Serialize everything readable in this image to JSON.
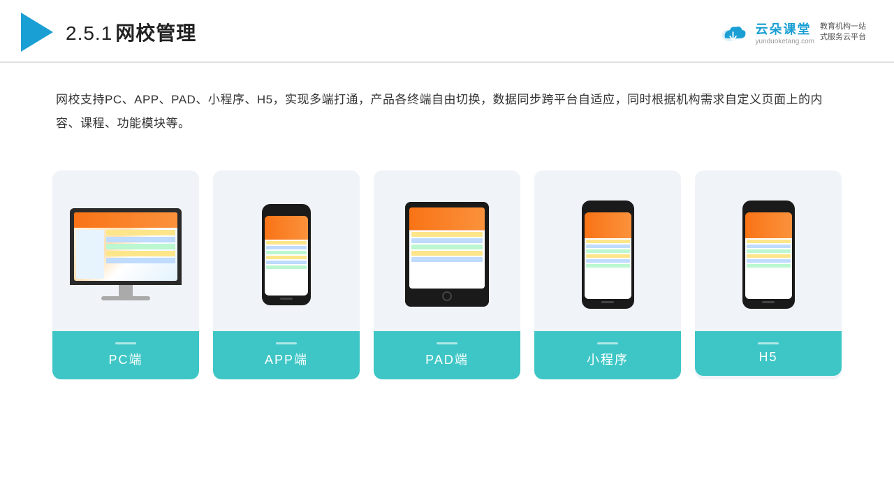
{
  "header": {
    "section_number": "2.5.1",
    "title": "网校管理",
    "brand_name": "云朵课堂",
    "brand_url": "yunduoketang.com",
    "brand_tagline": "教育机构一站\n式服务云平台"
  },
  "description": {
    "text": "网校支持PC、APP、PAD、小程序、H5，实现多端打通，产品各终端自由切换，数据同步跨平台自适应，同时根据机构需求自定义页面上的内容、课程、功能模块等。"
  },
  "cards": [
    {
      "id": "pc",
      "label": "PC端"
    },
    {
      "id": "app",
      "label": "APP端"
    },
    {
      "id": "pad",
      "label": "PAD端"
    },
    {
      "id": "miniapp",
      "label": "小程序"
    },
    {
      "id": "h5",
      "label": "H5"
    }
  ],
  "colors": {
    "accent": "#3ec6c6",
    "header_blue": "#1a9fd4",
    "text_dark": "#222",
    "text_body": "#333"
  }
}
